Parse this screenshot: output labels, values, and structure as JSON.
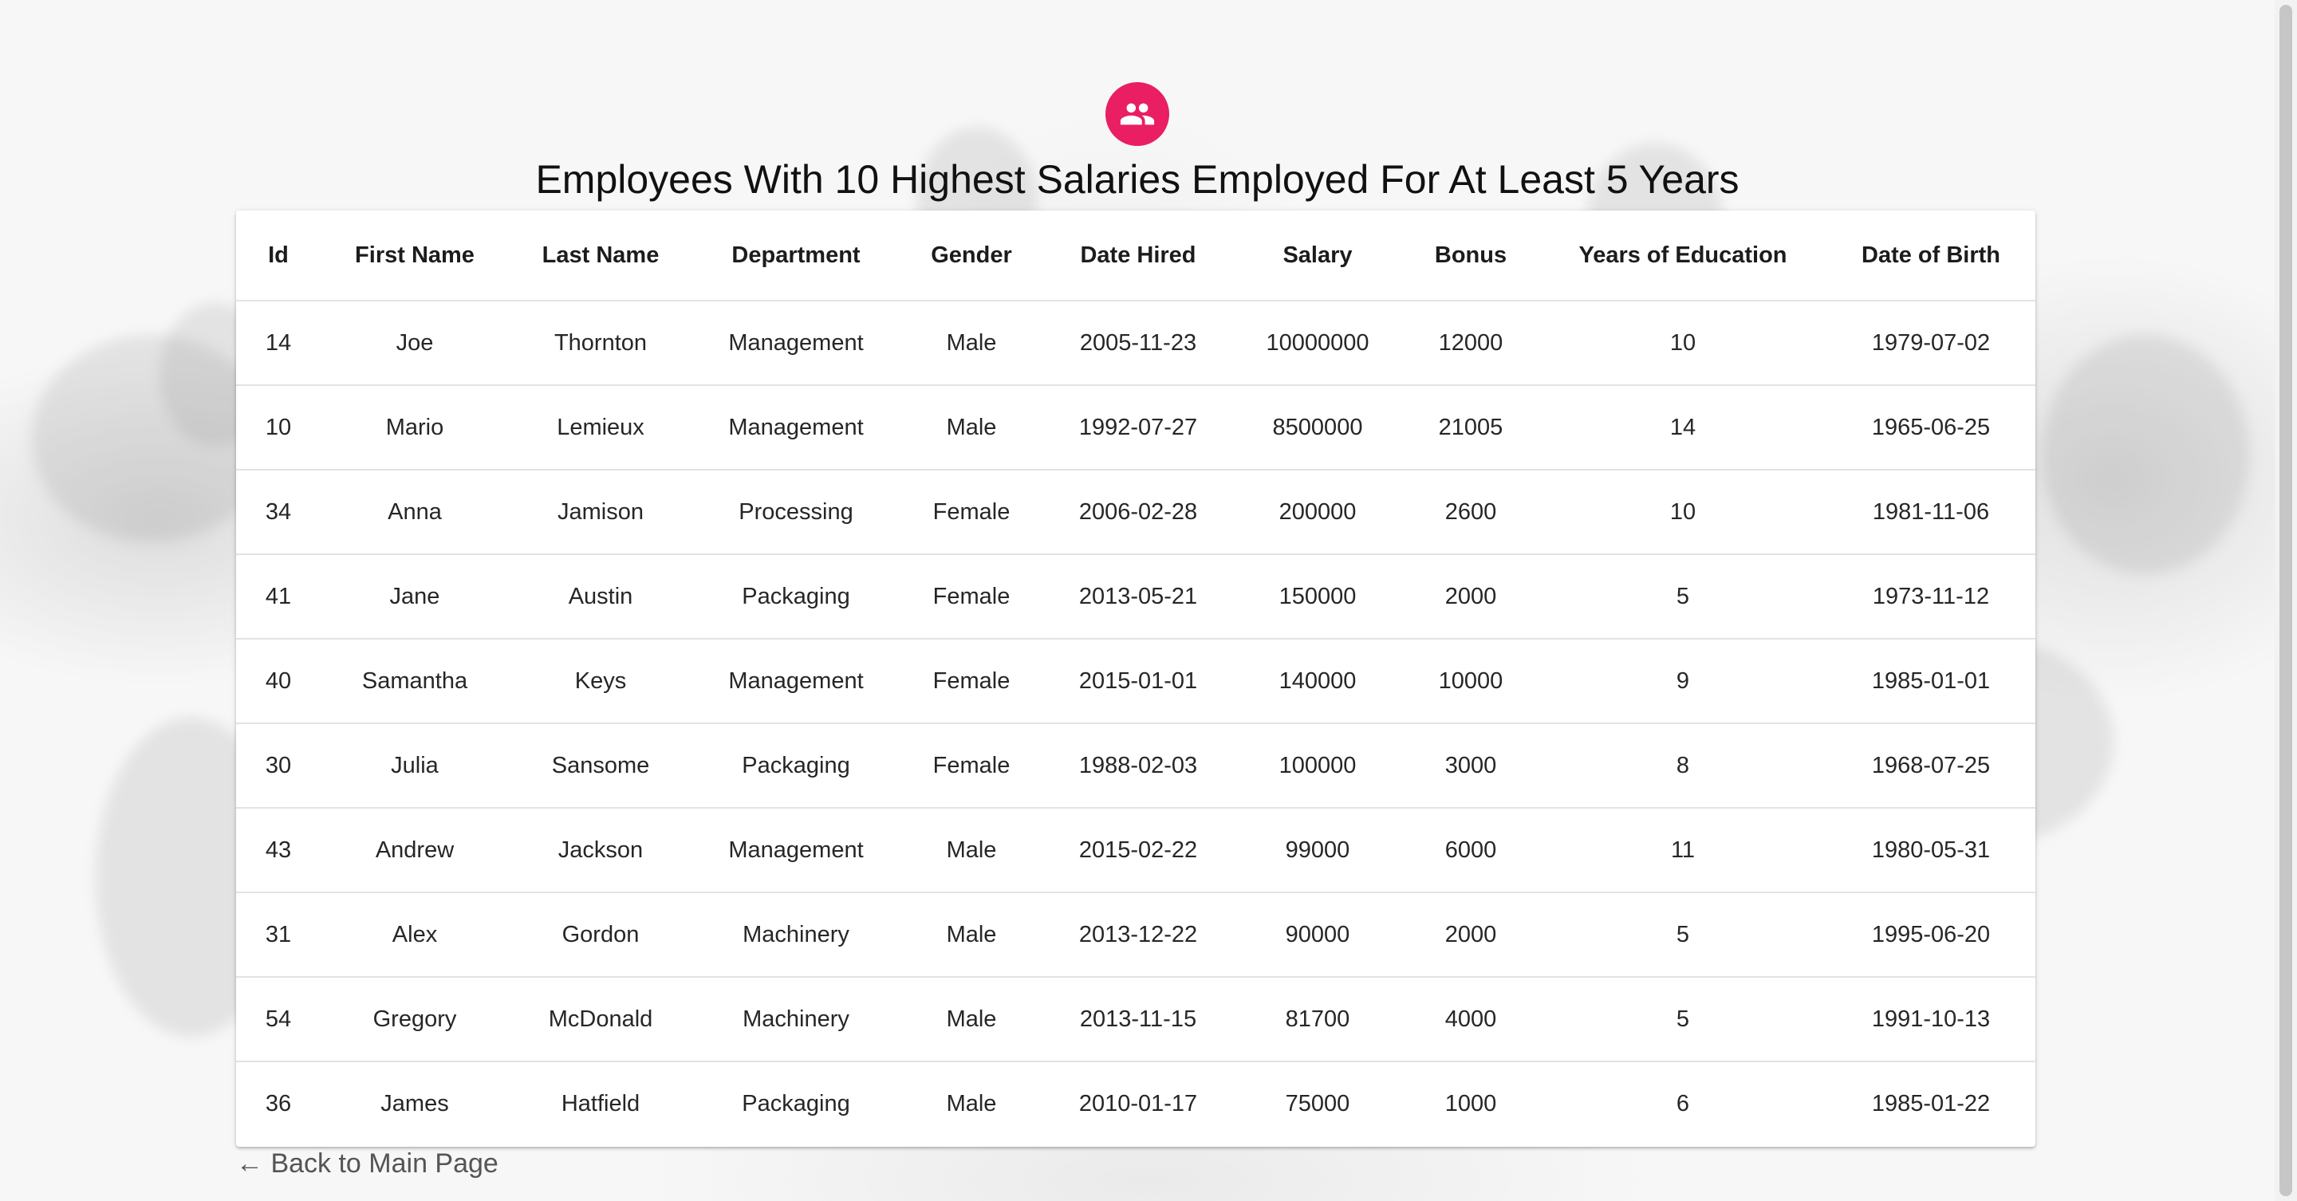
{
  "page": {
    "title": "Employees With 10 Highest Salaries Employed For At Least 5 Years",
    "avatar_icon": "people-icon",
    "accent_color": "#e91e63",
    "back_link": "← Back to Main Page"
  },
  "table": {
    "headers": [
      "Id",
      "First Name",
      "Last Name",
      "Department",
      "Gender",
      "Date Hired",
      "Salary",
      "Bonus",
      "Years of Education",
      "Date of Birth"
    ],
    "rows": [
      [
        "14",
        "Joe",
        "Thornton",
        "Management",
        "Male",
        "2005-11-23",
        "10000000",
        "12000",
        "10",
        "1979-07-02"
      ],
      [
        "10",
        "Mario",
        "Lemieux",
        "Management",
        "Male",
        "1992-07-27",
        "8500000",
        "21005",
        "14",
        "1965-06-25"
      ],
      [
        "34",
        "Anna",
        "Jamison",
        "Processing",
        "Female",
        "2006-02-28",
        "200000",
        "2600",
        "10",
        "1981-11-06"
      ],
      [
        "41",
        "Jane",
        "Austin",
        "Packaging",
        "Female",
        "2013-05-21",
        "150000",
        "2000",
        "5",
        "1973-11-12"
      ],
      [
        "40",
        "Samantha",
        "Keys",
        "Management",
        "Female",
        "2015-01-01",
        "140000",
        "10000",
        "9",
        "1985-01-01"
      ],
      [
        "30",
        "Julia",
        "Sansome",
        "Packaging",
        "Female",
        "1988-02-03",
        "100000",
        "3000",
        "8",
        "1968-07-25"
      ],
      [
        "43",
        "Andrew",
        "Jackson",
        "Management",
        "Male",
        "2015-02-22",
        "99000",
        "6000",
        "11",
        "1980-05-31"
      ],
      [
        "31",
        "Alex",
        "Gordon",
        "Machinery",
        "Male",
        "2013-12-22",
        "90000",
        "2000",
        "5",
        "1995-06-20"
      ],
      [
        "54",
        "Gregory",
        "McDonald",
        "Machinery",
        "Male",
        "2013-11-15",
        "81700",
        "4000",
        "5",
        "1991-10-13"
      ],
      [
        "36",
        "James",
        "Hatfield",
        "Packaging",
        "Male",
        "2010-01-17",
        "75000",
        "1000",
        "6",
        "1985-01-22"
      ]
    ]
  }
}
